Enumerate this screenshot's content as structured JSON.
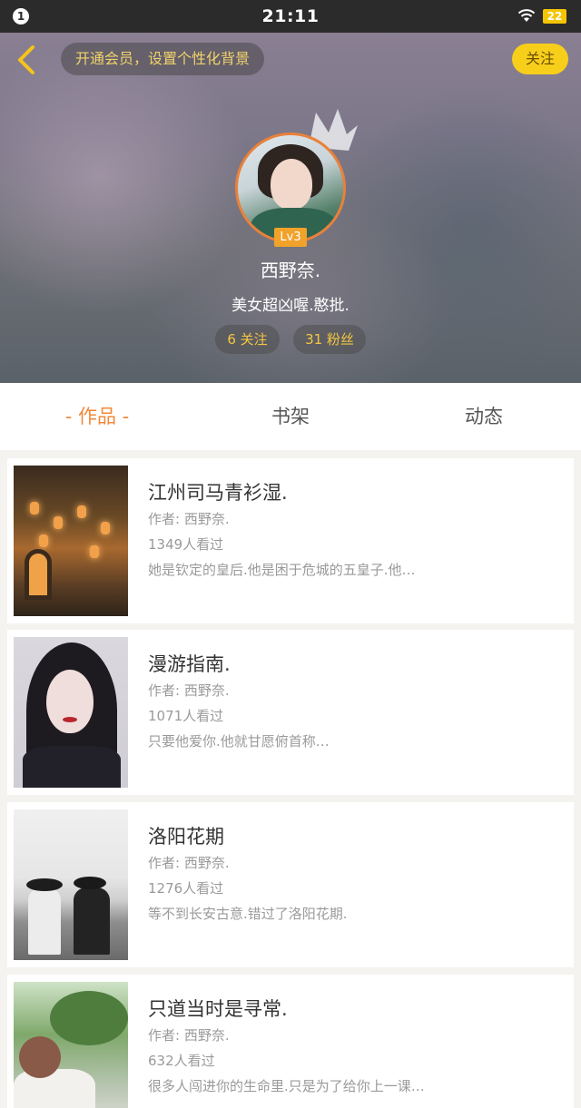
{
  "status_bar": {
    "notification_count": "1",
    "time": "21:11",
    "battery": "22"
  },
  "header": {
    "vip_banner": "开通会员，设置个性化背景",
    "follow_label": "关注",
    "level": "Lv3",
    "username": "西野奈.",
    "bio": "美女超凶喔.憨批.",
    "following": "6 关注",
    "fans": "31 粉丝",
    "accent_color": "#f7cf1b",
    "icons": [
      "back-arrow-icon",
      "crown-icon",
      "wifi-icon"
    ]
  },
  "tabs": [
    {
      "label": "- 作品 -",
      "active": true
    },
    {
      "label": "书架",
      "active": false
    },
    {
      "label": "动态",
      "active": false
    }
  ],
  "books": [
    {
      "title": "江州司马青衫湿.",
      "author": "作者: 西野奈.",
      "views": "1349人看过",
      "description": "她是钦定的皇后.他是困于危城的五皇子.他…"
    },
    {
      "title": "漫游指南.",
      "author": "作者: 西野奈.",
      "views": "1071人看过",
      "description": "只要他爱你.他就甘愿俯首称…"
    },
    {
      "title": "洛阳花期",
      "author": "作者: 西野奈.",
      "views": "1276人看过",
      "description": "等不到长安古意.错过了洛阳花期."
    },
    {
      "title": "只道当时是寻常.",
      "author": "作者: 西野奈.",
      "views": "632人看过",
      "description": "很多人闯进你的生命里.只是为了给你上一课…"
    }
  ]
}
